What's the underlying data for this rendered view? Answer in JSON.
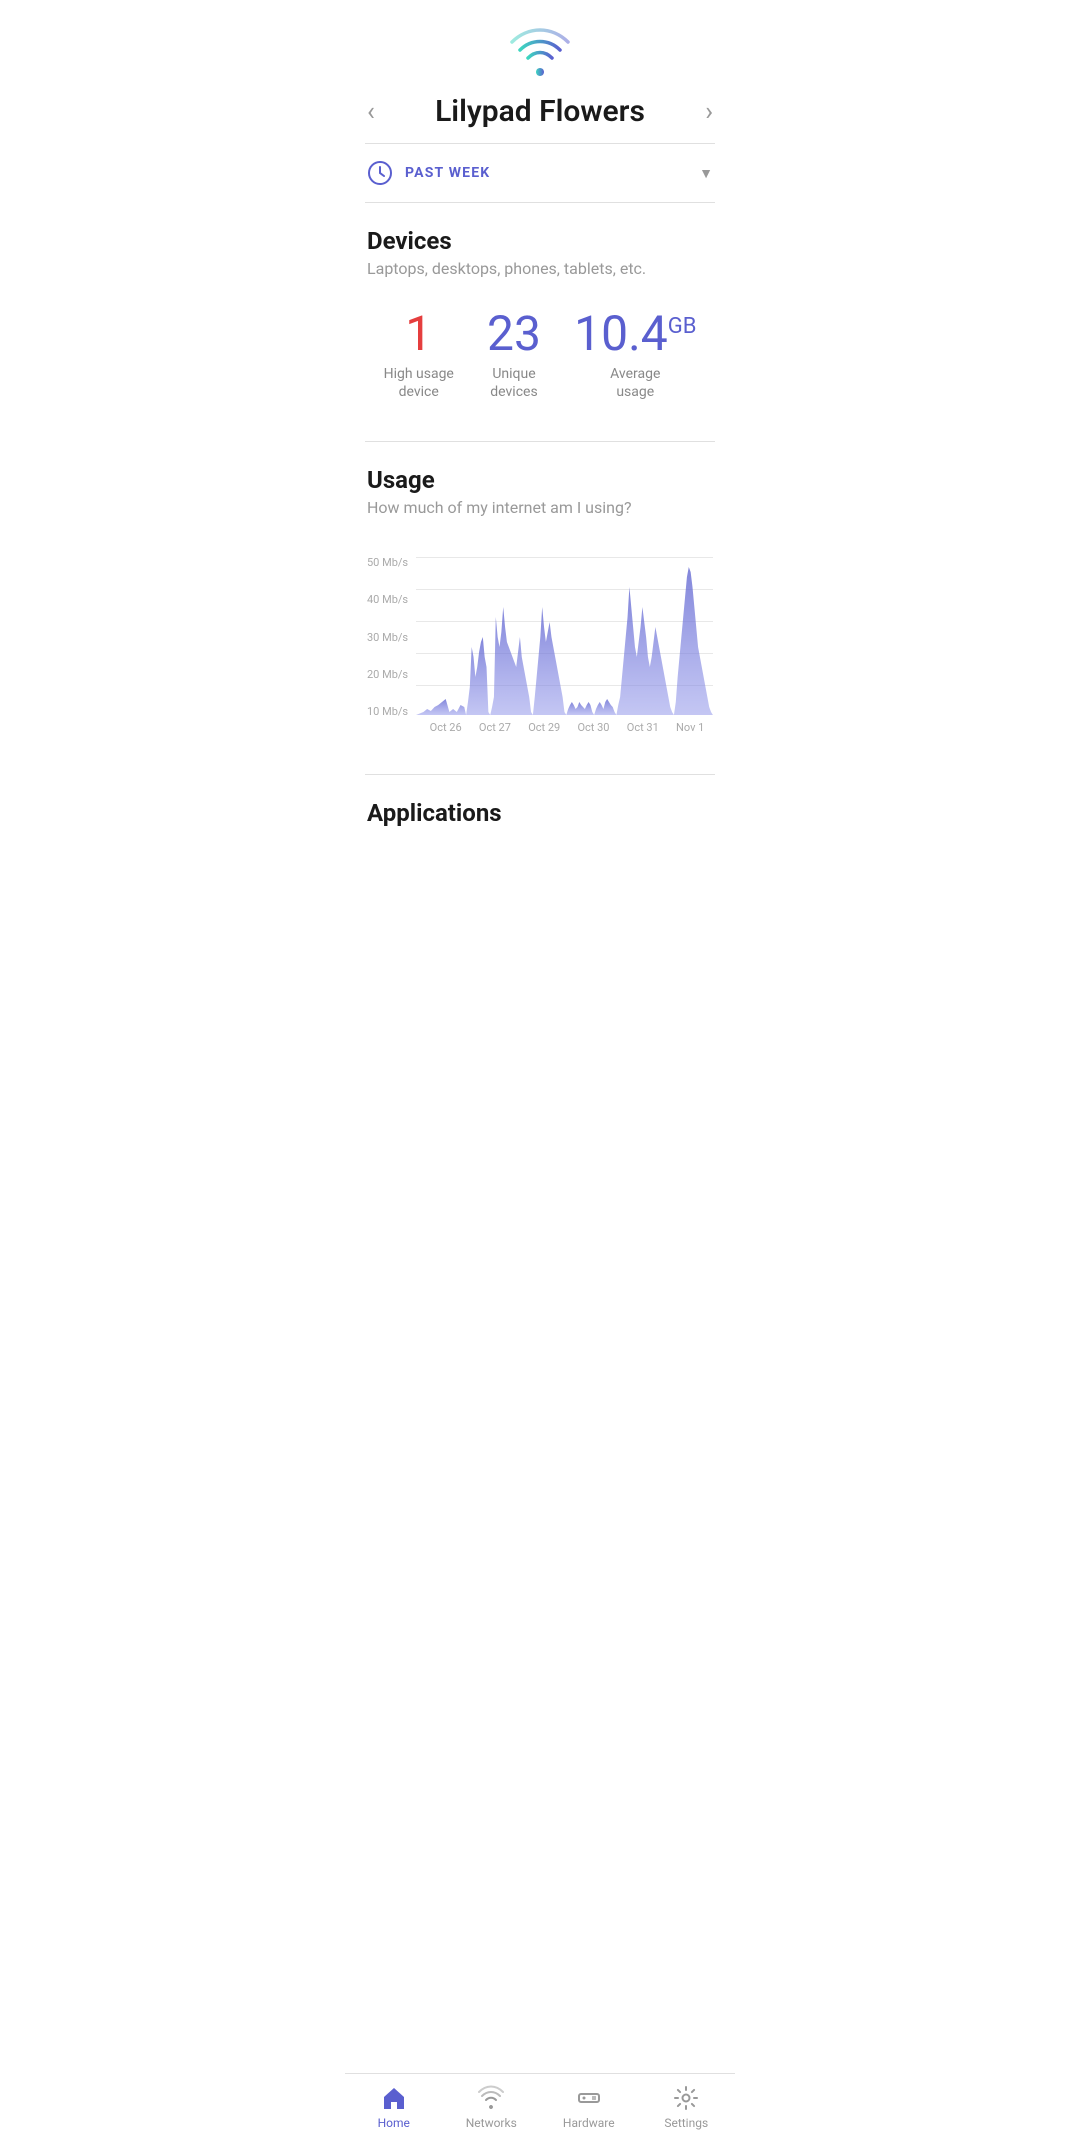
{
  "wifi": {
    "icon_label": "wifi-icon"
  },
  "header": {
    "title": "Lilypad Flowers",
    "prev_label": "‹",
    "next_label": "›"
  },
  "time_filter": {
    "label": "PAST WEEK",
    "icon": "clock"
  },
  "devices": {
    "section_title": "Devices",
    "section_subtitle": "Laptops, desktops, phones, tablets, etc.",
    "stats": [
      {
        "value": "1",
        "color": "red",
        "label": "High usage\ndevice",
        "label_line1": "High usage",
        "label_line2": "device"
      },
      {
        "value": "23",
        "color": "purple",
        "label": "Unique\ndevices",
        "label_line1": "Unique",
        "label_line2": "devices"
      },
      {
        "value": "10.4",
        "suffix": "GB",
        "color": "purple",
        "label": "Average\nusage",
        "label_line1": "Average",
        "label_line2": "usage"
      }
    ]
  },
  "usage": {
    "section_title": "Usage",
    "section_subtitle": "How much of my internet am I using?",
    "y_labels": [
      "50 Mb/s",
      "40 Mb/s",
      "30 Mb/s",
      "20 Mb/s",
      "10 Mb/s"
    ],
    "x_labels": [
      "Oct 26",
      "Oct 27",
      "Oct 29",
      "Oct 30",
      "Oct 31",
      "Nov 1"
    ]
  },
  "applications": {
    "section_title": "Applications"
  },
  "bottom_nav": {
    "items": [
      {
        "key": "home",
        "label": "Home",
        "active": true
      },
      {
        "key": "networks",
        "label": "Networks",
        "active": false
      },
      {
        "key": "hardware",
        "label": "Hardware",
        "active": false
      },
      {
        "key": "settings",
        "label": "Settings",
        "active": false
      }
    ]
  }
}
